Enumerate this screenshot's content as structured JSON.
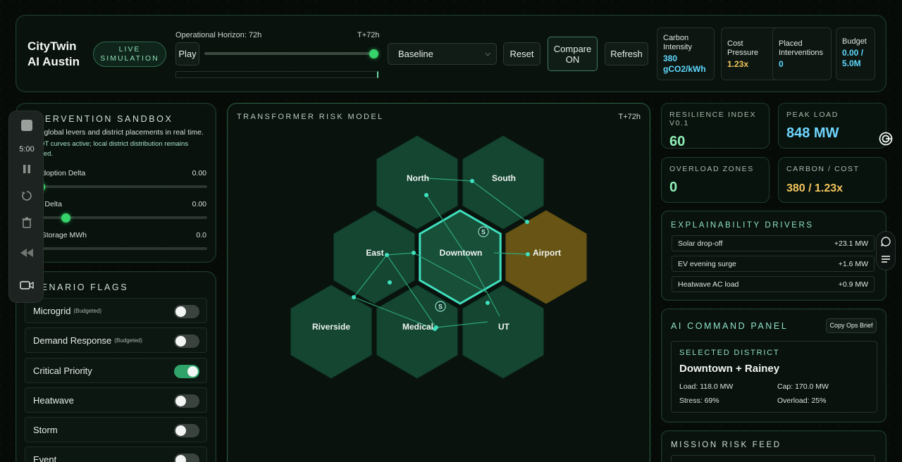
{
  "header": {
    "brand_line1": "CityTwin",
    "brand_line2": "AI Austin",
    "live_line1": "LIVE",
    "live_line2": "SIMULATION",
    "horizon_label": "Operational Horizon: 72h",
    "horizon_end": "T+72h",
    "horizon_fraction": 1.0,
    "play_label": "Play",
    "scenario_selected": "Baseline",
    "reset_label": "Reset",
    "compare_line1": "Compare",
    "compare_line2": "ON",
    "refresh_label": "Refresh",
    "metrics": [
      {
        "label_line1": "Carbon",
        "label_line2": "Intensity",
        "value_line1": "380",
        "value_line2": "gCO2/kWh",
        "color": "#5fd9ff"
      },
      {
        "label_line1": "Cost",
        "label_line2": "Pressure",
        "value_line1": "1.23x",
        "value_line2": "",
        "color": "#f3c55c"
      },
      {
        "label_line1": "Placed",
        "label_line2": "Interventions",
        "value_line1": "0",
        "value_line2": "",
        "color": "#5fd9ff"
      },
      {
        "label_line1": "Budget",
        "label_line2": "",
        "value_line1": "0.00 /",
        "value_line2": "5.0M",
        "color": "#5fd9ff"
      }
    ]
  },
  "sandbox": {
    "title": "INTERVENTION SANDBOX",
    "desc_line1": "Tune global levers and district placements in real time.",
    "desc_line2": "ERCOT curves active; local district distribution remains",
    "desc_line3": "modeled.",
    "levers": [
      {
        "label": "EV Adoption Delta",
        "value": "0.00",
        "fraction": 0.08
      },
      {
        "label": "Solar Delta",
        "value": "0.00",
        "fraction": 0.22
      },
      {
        "label": "Grid Storage MWh",
        "value": "0.0",
        "fraction": 0.0
      }
    ]
  },
  "flags": {
    "title": "SCENARIO FLAGS",
    "items": [
      {
        "label": "Microgrid",
        "note": "(Budgeted)",
        "on": false
      },
      {
        "label": "Demand Response",
        "note": "(Budgeted)",
        "on": false
      },
      {
        "label": "Critical Priority",
        "note": "",
        "on": true
      },
      {
        "label": "Heatwave",
        "note": "",
        "on": false
      },
      {
        "label": "Storm",
        "note": "",
        "on": false
      },
      {
        "label": "Event",
        "note": "",
        "on": false
      }
    ]
  },
  "recorder": {
    "time": "5:00"
  },
  "map": {
    "title": "TRANSFORMER RISK MODEL",
    "horizon": "T+72h",
    "districts": [
      {
        "name": "North",
        "col": 1,
        "row": 0,
        "status": "normal"
      },
      {
        "name": "South",
        "col": 2,
        "row": 0,
        "status": "normal"
      },
      {
        "name": "East",
        "col": 0,
        "row": 1,
        "status": "normal"
      },
      {
        "name": "Downtown",
        "col": 1,
        "row": 1,
        "status": "selected"
      },
      {
        "name": "Airport",
        "col": 2,
        "row": 1,
        "status": "warning"
      },
      {
        "name": "Riverside",
        "col": 0,
        "row": 2,
        "status": "normal"
      },
      {
        "name": "Medical",
        "col": 1,
        "row": 2,
        "status": "normal"
      },
      {
        "name": "UT",
        "col": 2,
        "row": 2,
        "status": "normal"
      }
    ],
    "storage_badge": "S",
    "colors": {
      "normal": "#16503a",
      "selected": "#1b5a42",
      "warning": "#6e5a16",
      "edge": "#2fa57a",
      "accent": "#3fe0bf"
    }
  },
  "kpis": [
    {
      "label": "RESILIENCE INDEX V0.1",
      "value": "60",
      "color": "#8ff0b8"
    },
    {
      "label": "PEAK LOAD",
      "value": "848 MW",
      "color": "#6fd6ff"
    },
    {
      "label": "OVERLOAD ZONES",
      "value": "0",
      "color": "#8ff0b8"
    },
    {
      "label": "CARBON / COST",
      "value": "380 / 1.23x",
      "color": "#f3c55c"
    }
  ],
  "drivers": {
    "title": "EXPLAINABILITY DRIVERS",
    "items": [
      {
        "label": "Solar drop-off",
        "value": "+23.1 MW"
      },
      {
        "label": "EV evening surge",
        "value": "+1.6 MW"
      },
      {
        "label": "Heatwave AC load",
        "value": "+0.9 MW"
      }
    ]
  },
  "command": {
    "title": "AI COMMAND PANEL",
    "copy_label": "Copy Ops Brief",
    "selected_label": "SELECTED DISTRICT",
    "district": "Downtown + Rainey",
    "load": "Load: 118.0 MW",
    "cap": "Cap: 170.0 MW",
    "stress": "Stress: 69%",
    "overload": "Overload: 25%"
  },
  "feed": {
    "title": "MISSION RISK FEED"
  }
}
